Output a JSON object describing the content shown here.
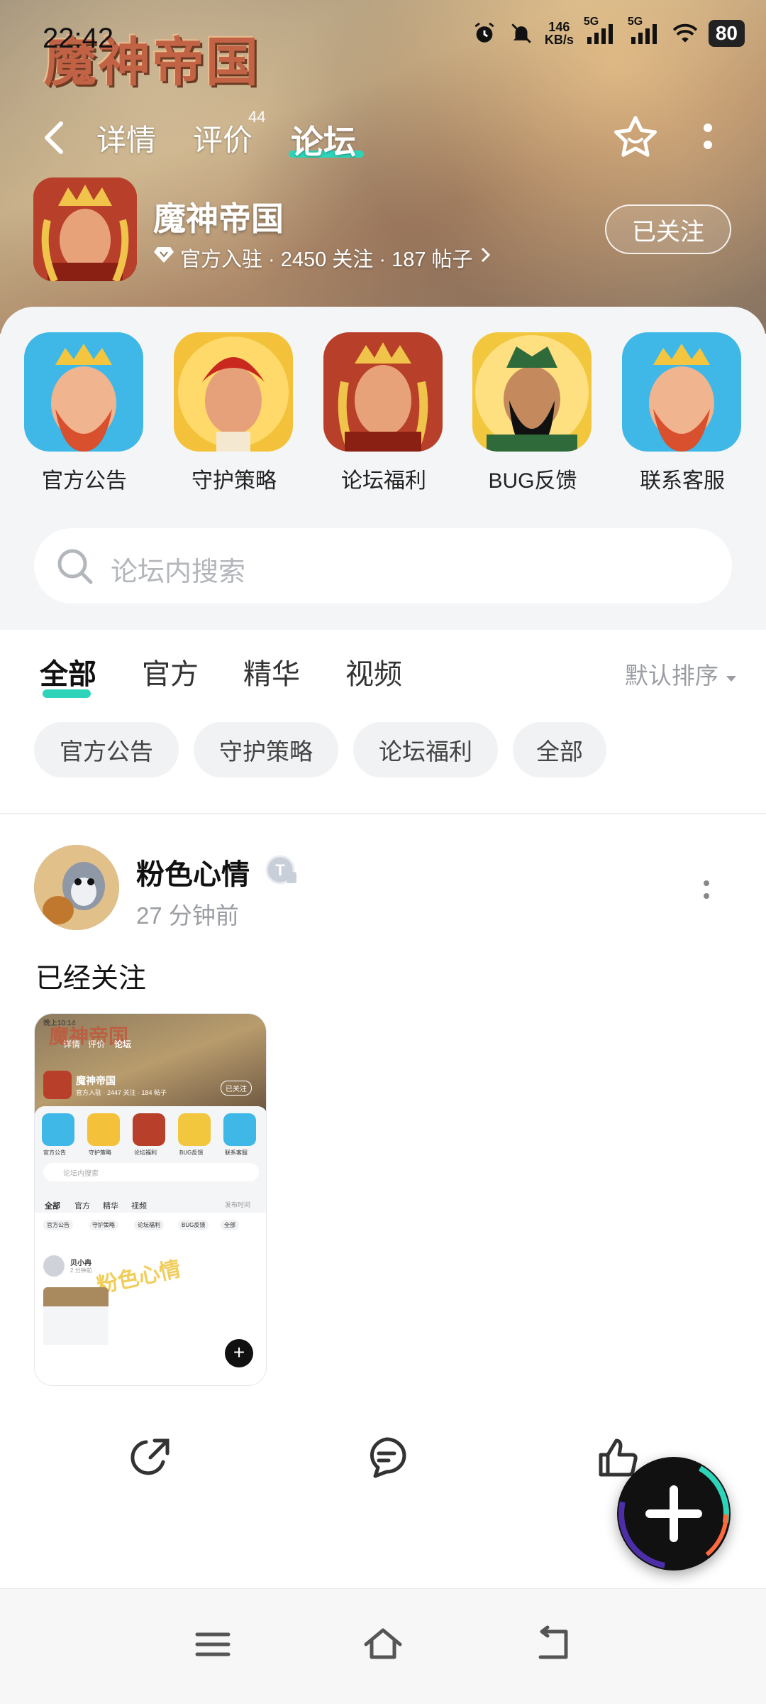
{
  "status_bar": {
    "time": "22:42",
    "net_speed_value": "146",
    "net_speed_unit": "KB/s",
    "signal1": "5G",
    "signal2": "5G",
    "battery": "80"
  },
  "header": {
    "logo_text": "魔神帝国",
    "tabs": [
      {
        "label": "详情"
      },
      {
        "label": "评价",
        "badge": "44"
      },
      {
        "label": "论坛",
        "active": true
      }
    ],
    "game_title": "魔神帝国",
    "meta_official": "官方入驻",
    "meta_stats": "· 2450 关注 · 187 帖子",
    "follow_label": "已关注"
  },
  "quick_links": [
    {
      "label": "官方公告"
    },
    {
      "label": "守护策略"
    },
    {
      "label": "论坛福利"
    },
    {
      "label": "BUG反馈"
    },
    {
      "label": "联系客服"
    }
  ],
  "search": {
    "placeholder": "论坛内搜索"
  },
  "feed_tabs": [
    {
      "label": "全部",
      "active": true
    },
    {
      "label": "官方"
    },
    {
      "label": "精华"
    },
    {
      "label": "视频"
    }
  ],
  "sort_label": "默认排序",
  "chips": [
    {
      "label": "官方公告"
    },
    {
      "label": "守护策略"
    },
    {
      "label": "论坛福利"
    },
    {
      "label": "全部"
    }
  ],
  "post": {
    "author": "粉色心情",
    "time": "27 分钟前",
    "text": "已经关注",
    "image": {
      "time": "晚上10:14",
      "logo": "魔神帝国",
      "tabs": [
        "详情",
        "评价",
        "论坛"
      ],
      "title": "魔神帝国",
      "meta": "官方入驻 · 2447 关注 · 184 帖子",
      "follow": "已关注",
      "quick": [
        "官方公告",
        "守护策略",
        "论坛福利",
        "BUG反馈",
        "联系客服"
      ],
      "search": "论坛内搜索",
      "feed_tabs": [
        "全部",
        "官方",
        "精华",
        "视频"
      ],
      "sort": "发布时间",
      "chips": [
        "官方公告",
        "守护策略",
        "论坛福利",
        "BUG反馈",
        "全部"
      ],
      "author": "贝小冉",
      "time2": "2 分钟前",
      "watermark": "粉色心情"
    }
  },
  "colors": {
    "accent": "#2dd4b9",
    "text": "#111111",
    "muted": "#9a9da2",
    "chip_bg": "#f1f2f4"
  }
}
